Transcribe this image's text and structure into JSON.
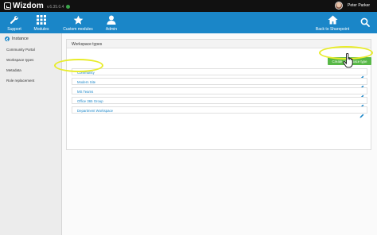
{
  "app": {
    "name": "Wizdom",
    "version": "v.6.35.0.4",
    "user_name": "Peter Parker"
  },
  "navbar": {
    "items": [
      {
        "label": "Support",
        "icon": "wrench-icon"
      },
      {
        "label": "Modules",
        "icon": "grid-icon"
      },
      {
        "label": "Custom modules",
        "icon": "star-icon"
      },
      {
        "label": "Admin",
        "icon": "person-icon"
      },
      {
        "label": "Back to Sharepoint",
        "icon": "home-icon"
      },
      {
        "label": "",
        "icon": "search-icon"
      }
    ]
  },
  "sidebar": {
    "title": "Instance",
    "items": [
      {
        "label": "Community Portal"
      },
      {
        "label": "Workspace types"
      },
      {
        "label": "Metadata"
      },
      {
        "label": "Role replacement"
      }
    ]
  },
  "panel": {
    "title": "Workspace types",
    "create_label": "Create workspace type",
    "rows": [
      {
        "name": "Community"
      },
      {
        "name": "Modern Site"
      },
      {
        "name": "MS Teams"
      },
      {
        "name": "Office 365 Group"
      },
      {
        "name": "Department Workspace"
      }
    ]
  },
  "colors": {
    "topbar": "#111111",
    "navbar": "#1a86c8",
    "accent_green": "#58b847",
    "highlight": "#e8ec2a",
    "link": "#1a86c8"
  }
}
